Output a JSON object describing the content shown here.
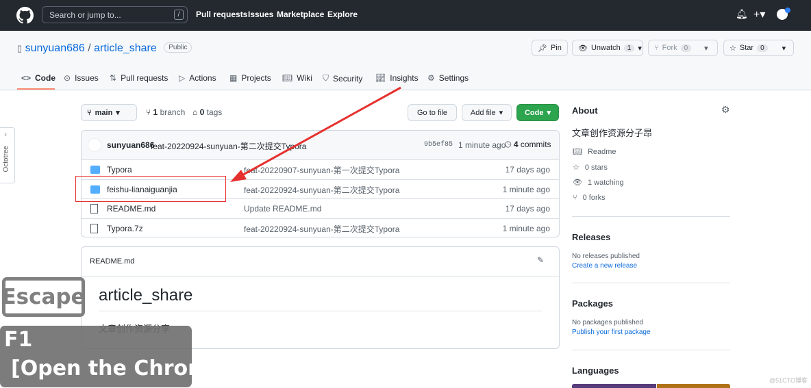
{
  "header": {
    "search_placeholder": "Search or jump to...",
    "slash": "/",
    "nav": [
      "Pull requests",
      "Issues",
      "Marketplace",
      "Explore"
    ]
  },
  "repo": {
    "owner": "sunyuan686",
    "sep": "/",
    "name": "article_share",
    "visibility": "Public",
    "pin": "Pin",
    "unwatch": "Unwatch",
    "watch_count": "1",
    "fork": "Fork",
    "fork_count": "0",
    "star": "Star",
    "star_count": "0"
  },
  "tabs": [
    "Code",
    "Issues",
    "Pull requests",
    "Actions",
    "Projects",
    "Wiki",
    "Security",
    "Insights",
    "Settings"
  ],
  "toolbar": {
    "branch": "main",
    "branches_count": "1",
    "branches_label": "branch",
    "tags_count": "0",
    "tags_label": "tags",
    "go_to_file": "Go to file",
    "add_file": "Add file",
    "code": "Code"
  },
  "commit": {
    "author": "sunyuan686",
    "message": "feat-20220924-sunyuan-第二次提交Typora",
    "sha": "9b5ef85",
    "time": "1 minute ago",
    "commits_count": "4",
    "commits_label": "commits"
  },
  "files": [
    {
      "type": "folder",
      "name": "Typora",
      "message": "feat-20220907-sunyuan-第一次提交Typora",
      "age": "17 days ago"
    },
    {
      "type": "folder",
      "name": "feishu-lianaiguanjia",
      "message": "feat-20220924-sunyuan-第二次提交Typora",
      "age": "1 minute ago"
    },
    {
      "type": "file",
      "name": "README.md",
      "message": "Update README.md",
      "age": "17 days ago"
    },
    {
      "type": "file",
      "name": "Typora.7z",
      "message": "feat-20220924-sunyuan-第二次提交Typora",
      "age": "1 minute ago"
    }
  ],
  "readme": {
    "filename": "README.md",
    "title": "article_share",
    "body": "文章创作资源分享"
  },
  "about": {
    "heading": "About",
    "description": "文章创作资源分子昂",
    "readme": "Readme",
    "stars": "0 stars",
    "watching": "1 watching",
    "forks": "0 forks"
  },
  "releases": {
    "heading": "Releases",
    "none": "No releases published",
    "link": "Create a new release"
  },
  "packages": {
    "heading": "Packages",
    "none": "No packages published",
    "link": "Publish your first package"
  },
  "languages": {
    "heading": "Languages",
    "colors": [
      "#563d7c",
      "#b07219"
    ]
  },
  "octotree": "Octotree",
  "overlay": {
    "key": "Escape",
    "hint_key": "F1",
    "hint_text": "[Open the Chron"
  },
  "watermark": "@51CTO博客",
  "colors": {
    "accent": "#0969da",
    "primary": "#2da44e",
    "annotation": "#e5312e"
  }
}
